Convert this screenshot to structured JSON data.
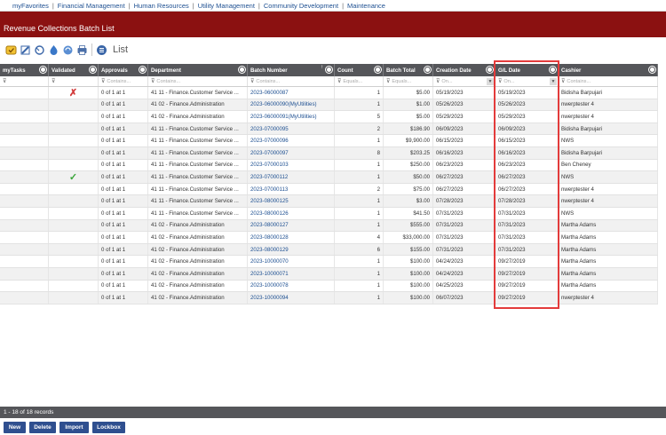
{
  "topnav": {
    "items": [
      "myFavorites",
      "Financial Management",
      "Human Resources",
      "Utility Management",
      "Community Development",
      "Maintenance"
    ]
  },
  "page": {
    "title": "Revenue Collections Batch List"
  },
  "toolbar": {
    "list_label": "List",
    "icons": [
      "favorite-icon",
      "edit-icon",
      "refresh-icon",
      "process-icon",
      "sync-icon",
      "print-icon",
      "list-view-icon"
    ]
  },
  "grid": {
    "columns": [
      {
        "key": "mytasks",
        "label": "myTasks",
        "filter": ""
      },
      {
        "key": "validated",
        "label": "Validated",
        "filter": ""
      },
      {
        "key": "approvals",
        "label": "Approvals",
        "filter": "Contains..."
      },
      {
        "key": "department",
        "label": "Department",
        "filter": "Contains..."
      },
      {
        "key": "batch",
        "label": "Batch Number",
        "filter": "Contains..."
      },
      {
        "key": "count",
        "label": "Count",
        "filter": "Equals..."
      },
      {
        "key": "total",
        "label": "Batch Total",
        "filter": "Equals..."
      },
      {
        "key": "created",
        "label": "Creation Date",
        "filter": "On..."
      },
      {
        "key": "gldate",
        "label": "G/L Date",
        "filter": "On..."
      },
      {
        "key": "cashier",
        "label": "Cashier",
        "filter": "Contains..."
      }
    ],
    "sort_indicator": "↑",
    "rows": [
      {
        "validated": "✗",
        "approvals": "0 of 1 at 1",
        "department": "41 11 - Finance.Customer Service ...",
        "batch": "2023-06000087",
        "count": "1",
        "total": "$5.00",
        "created": "05/19/2023",
        "gldate": "05/19/2023",
        "cashier": "Bidisha Barpujari"
      },
      {
        "validated": "",
        "approvals": "0 of 1 at 1",
        "department": "41 02 - Finance.Administration",
        "batch": "2023-06000090(MyUtilities)",
        "count": "1",
        "total": "$1.00",
        "created": "05/26/2023",
        "gldate": "05/26/2023",
        "cashier": "nwerptester 4"
      },
      {
        "validated": "",
        "approvals": "0 of 1 at 1",
        "department": "41 02 - Finance.Administration",
        "batch": "2023-06000091(MyUtilities)",
        "count": "5",
        "total": "$5.00",
        "created": "05/29/2023",
        "gldate": "05/29/2023",
        "cashier": "nwerptester 4"
      },
      {
        "validated": "",
        "approvals": "0 of 1 at 1",
        "department": "41 11 - Finance.Customer Service ...",
        "batch": "2023-07000095",
        "count": "2",
        "total": "$186.90",
        "created": "06/09/2023",
        "gldate": "06/09/2023",
        "cashier": "Bidisha Barpujari"
      },
      {
        "validated": "",
        "approvals": "0 of 1 at 1",
        "department": "41 11 - Finance.Customer Service ...",
        "batch": "2023-07000096",
        "count": "1",
        "total": "$9,900.00",
        "created": "06/15/2023",
        "gldate": "06/15/2023",
        "cashier": "NWS"
      },
      {
        "validated": "",
        "approvals": "0 of 1 at 1",
        "department": "41 11 - Finance.Customer Service ...",
        "batch": "2023-07000097",
        "count": "8",
        "total": "$203.25",
        "created": "06/16/2023",
        "gldate": "06/16/2023",
        "cashier": "Bidisha Barpujari"
      },
      {
        "validated": "",
        "approvals": "0 of 1 at 1",
        "department": "41 11 - Finance.Customer Service ...",
        "batch": "2023-07000103",
        "count": "1",
        "total": "$250.00",
        "created": "06/23/2023",
        "gldate": "06/23/2023",
        "cashier": "Ben Cheney"
      },
      {
        "validated": "✓",
        "approvals": "0 of 1 at 1",
        "department": "41 11 - Finance.Customer Service ...",
        "batch": "2023-07000112",
        "count": "1",
        "total": "$50.00",
        "created": "06/27/2023",
        "gldate": "06/27/2023",
        "cashier": "NWS"
      },
      {
        "validated": "",
        "approvals": "0 of 1 at 1",
        "department": "41 11 - Finance.Customer Service ...",
        "batch": "2023-07000113",
        "count": "2",
        "total": "$75.00",
        "created": "06/27/2023",
        "gldate": "06/27/2023",
        "cashier": "nwerptester 4"
      },
      {
        "validated": "",
        "approvals": "0 of 1 at 1",
        "department": "41 11 - Finance.Customer Service ...",
        "batch": "2023-08000125",
        "count": "1",
        "total": "$3.00",
        "created": "07/28/2023",
        "gldate": "07/28/2023",
        "cashier": "nwerptester 4"
      },
      {
        "validated": "",
        "approvals": "0 of 1 at 1",
        "department": "41 11 - Finance.Customer Service ...",
        "batch": "2023-08000126",
        "count": "1",
        "total": "$41.50",
        "created": "07/31/2023",
        "gldate": "07/31/2023",
        "cashier": "NWS"
      },
      {
        "validated": "",
        "approvals": "0 of 1 at 1",
        "department": "41 02 - Finance.Administration",
        "batch": "2023-08000127",
        "count": "1",
        "total": "$555.00",
        "created": "07/31/2023",
        "gldate": "07/31/2023",
        "cashier": "Martha Adams"
      },
      {
        "validated": "",
        "approvals": "0 of 1 at 1",
        "department": "41 02 - Finance.Administration",
        "batch": "2023-08000128",
        "count": "4",
        "total": "$33,000.00",
        "created": "07/31/2023",
        "gldate": "07/31/2023",
        "cashier": "Martha Adams"
      },
      {
        "validated": "",
        "approvals": "0 of 1 at 1",
        "department": "41 02 - Finance.Administration",
        "batch": "2023-08000129",
        "count": "6",
        "total": "$155.00",
        "created": "07/31/2023",
        "gldate": "07/31/2023",
        "cashier": "Martha Adams"
      },
      {
        "validated": "",
        "approvals": "0 of 1 at 1",
        "department": "41 02 - Finance.Administration",
        "batch": "2023-10000070",
        "count": "1",
        "total": "$100.00",
        "created": "04/24/2023",
        "gldate": "09/27/2019",
        "cashier": "Martha Adams"
      },
      {
        "validated": "",
        "approvals": "0 of 1 at 1",
        "department": "41 02 - Finance.Administration",
        "batch": "2023-10000071",
        "count": "1",
        "total": "$100.00",
        "created": "04/24/2023",
        "gldate": "09/27/2019",
        "cashier": "Martha Adams"
      },
      {
        "validated": "",
        "approvals": "0 of 1 at 1",
        "department": "41 02 - Finance.Administration",
        "batch": "2023-10000078",
        "count": "1",
        "total": "$100.00",
        "created": "04/25/2023",
        "gldate": "09/27/2019",
        "cashier": "Martha Adams"
      },
      {
        "validated": "",
        "approvals": "0 of 1 at 1",
        "department": "41 02 - Finance.Administration",
        "batch": "2023-10000094",
        "count": "1",
        "total": "$100.00",
        "created": "06/07/2023",
        "gldate": "09/27/2019",
        "cashier": "nwerptester 4"
      }
    ]
  },
  "footer": {
    "records_text": "1 - 18 of 18 records"
  },
  "buttons": {
    "new": "New",
    "delete": "Delete",
    "import": "Import",
    "lockbox": "Lockbox"
  },
  "colors": {
    "brand": "#8b1111",
    "header": "#55565a",
    "link": "#1d4f91",
    "highlight": "#e33b3b",
    "button": "#2f4f8f",
    "valid": "#3aa53a",
    "invalid": "#d23b3b"
  }
}
